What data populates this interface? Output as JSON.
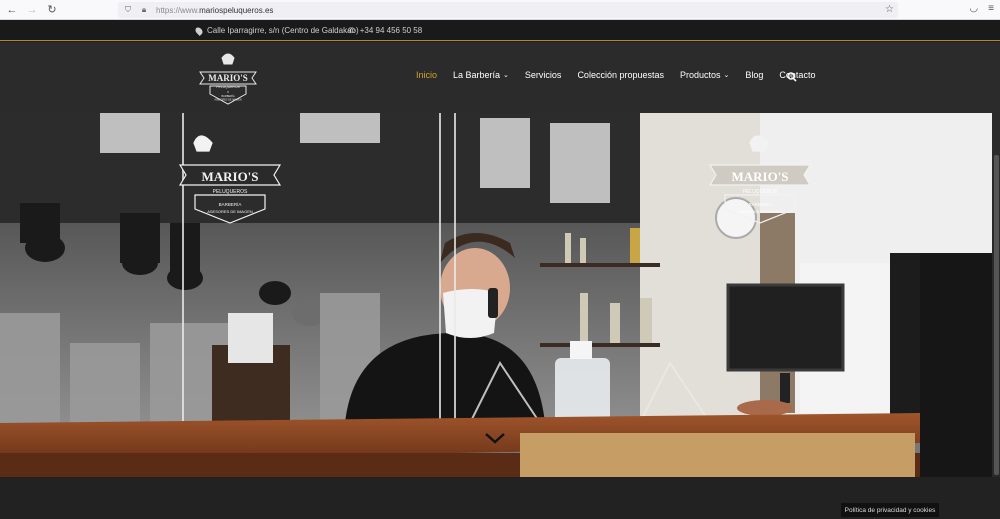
{
  "browser": {
    "url_prefix": "https://www.",
    "url_domain": "mariospeluqueros.es"
  },
  "info_bar": {
    "address": "Calle Iparragirre, s/n (Centro de Galdakao)",
    "phone": "+34 94 456 50 58"
  },
  "brand": {
    "name": "MARIO'S",
    "sub": "PELUQUEROS",
    "x": "X",
    "tag1": "BARBERÍA",
    "tag2": "ASESORES DE IMAGEN",
    "since_left": "DESDE",
    "since_right": "1990"
  },
  "menu": {
    "items": [
      {
        "label": "Inicio",
        "active": true,
        "dropdown": false
      },
      {
        "label": "La Barbería",
        "active": false,
        "dropdown": true
      },
      {
        "label": "Servicios",
        "active": false,
        "dropdown": false
      },
      {
        "label": "Colección propuestas",
        "active": false,
        "dropdown": false
      },
      {
        "label": "Productos",
        "active": false,
        "dropdown": true
      },
      {
        "label": "Blog",
        "active": false,
        "dropdown": false
      },
      {
        "label": "Contacto",
        "active": false,
        "dropdown": false
      }
    ]
  },
  "cookie_notice": "Política de privacidad y cookies",
  "colors": {
    "accent": "#d4a32a",
    "header_bg": "#2b2b2b",
    "topbar_bg": "#1a1a1a"
  }
}
